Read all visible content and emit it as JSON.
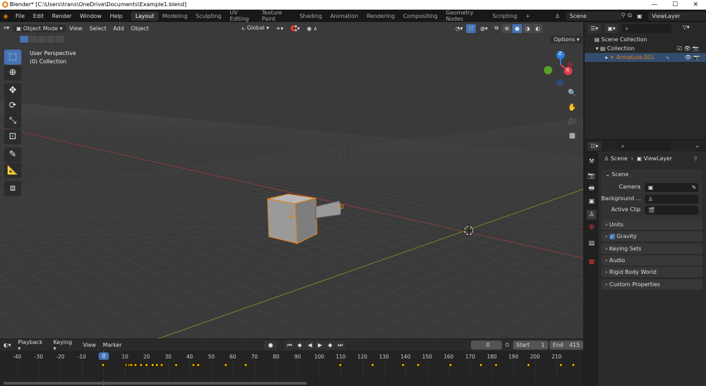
{
  "title": "Blender* [C:\\Users\\trans\\OneDrive\\Documents\\Example1.blend]",
  "window_controls": [
    "—",
    "☐",
    "✕"
  ],
  "menus": [
    "File",
    "Edit",
    "Render",
    "Window",
    "Help"
  ],
  "workspaces": [
    "Layout",
    "Modeling",
    "Sculpting",
    "UV Editing",
    "Texture Paint",
    "Shading",
    "Animation",
    "Rendering",
    "Compositing",
    "Geometry Nodes",
    "Scripting",
    "+"
  ],
  "active_workspace": "Layout",
  "scene_field": "Scene",
  "viewlayer_field": "ViewLayer",
  "viewport": {
    "mode": "Object Mode",
    "menus": [
      "View",
      "Select",
      "Add",
      "Object"
    ],
    "orientation": "Global",
    "options": "Options",
    "overlay_text": [
      "User Perspective",
      "(0) Collection"
    ],
    "gizmo": {
      "z": "Z",
      "y": "Y",
      "x": "X"
    }
  },
  "outliner": {
    "scene_collection": "Scene Collection",
    "collection": "Collection",
    "object": "Armature.001"
  },
  "properties": {
    "breadcrumb": [
      "Scene",
      "ViewLayer"
    ],
    "scene_panel": "Scene",
    "fields": [
      {
        "label": "Camera"
      },
      {
        "label": "Background ..."
      },
      {
        "label": "Active Clip"
      }
    ],
    "panels": [
      "Units",
      "Gravity",
      "Keying Sets",
      "Audio",
      "Rigid Body World",
      "Custom Properties"
    ],
    "gravity_checked": true
  },
  "timeline": {
    "menus": [
      "Playback",
      "Keying",
      "View",
      "Marker"
    ],
    "current_frame": "0",
    "start_label": "Start",
    "start": "1",
    "end_label": "End",
    "end": "415",
    "ticks": [
      "-40",
      "-30",
      "-20",
      "-10",
      "0",
      "10",
      "20",
      "30",
      "40",
      "50",
      "60",
      "70",
      "80",
      "90",
      "100",
      "110",
      "120",
      "130",
      "140",
      "150",
      "160",
      "170",
      "180",
      "190",
      "200",
      "210"
    ],
    "keyframes": [
      0,
      11,
      11.7,
      12.3,
      13,
      15,
      17.5,
      20,
      23,
      25,
      27,
      34,
      42,
      44,
      57,
      66,
      110,
      125,
      139,
      146,
      161,
      175,
      182,
      197,
      212,
      218
    ]
  },
  "colors": {
    "accent": "#4772b3",
    "selection": "#e87d0d",
    "keyframe": "#f2b600"
  }
}
